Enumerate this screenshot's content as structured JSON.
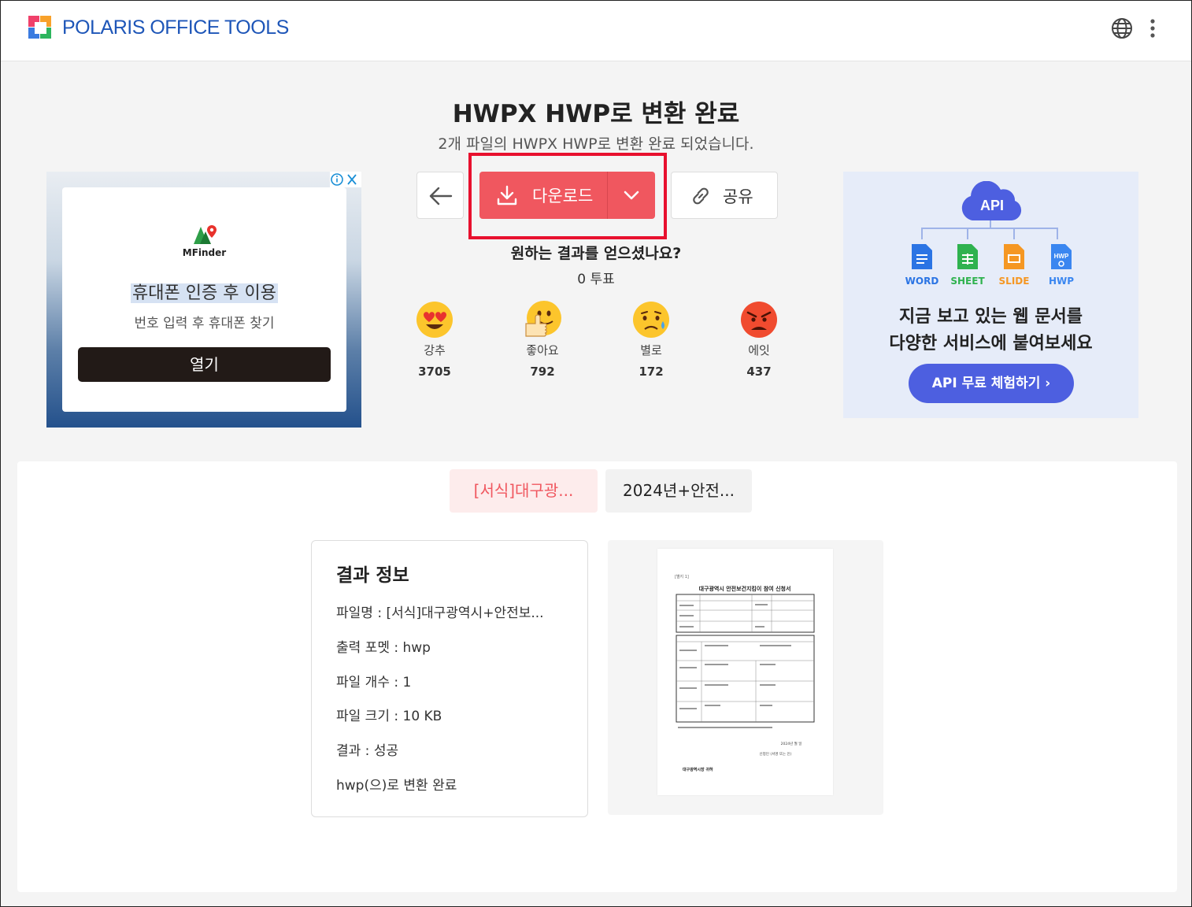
{
  "header": {
    "brand": "POLARIS OFFICE TOOLS",
    "language_icon": "globe-icon",
    "menu_icon": "more-vertical-icon"
  },
  "main": {
    "title": "HWPX HWP로 변환 완료",
    "subtitle": "2개 파일의 HWPX HWP로 변환 완료 되었습니다.",
    "download_label": "다운로드",
    "share_label": "공유",
    "question": "원하는 결과를 얻으셨나요?",
    "votes": "0 투표",
    "reactions": [
      {
        "label": "강추",
        "count": "3705",
        "icon": "heart-eyes-emoji-icon"
      },
      {
        "label": "좋아요",
        "count": "792",
        "icon": "thumbs-up-emoji-icon"
      },
      {
        "label": "별로",
        "count": "172",
        "icon": "sad-emoji-icon"
      },
      {
        "label": "에잇",
        "count": "437",
        "icon": "angry-emoji-icon"
      }
    ]
  },
  "ad_left": {
    "brand": "MFinder",
    "headline": "휴대폰 인증 후 이용",
    "sub": "번호 입력 후 휴대폰 찾기",
    "button": "열기"
  },
  "ad_right": {
    "api_badge": "API",
    "doc_types": [
      "WORD",
      "SHEET",
      "SLIDE",
      "HWP"
    ],
    "line1": "지금 보고 있는 웹 문서를",
    "line2": "다양한 서비스에 붙여보세요",
    "button": "API 무료 체험하기 ›"
  },
  "files": {
    "tabs": [
      "[서식]대구광...",
      "2024년+안전..."
    ],
    "active_tab": 0
  },
  "result": {
    "title": "결과 정보",
    "rows": [
      "파일명 : [서식]대구광역시+안전보...",
      "출력 포멧 : hwp",
      "파일 개수 : 1",
      "파일 크기 : 10 KB",
      "결과 : 성공",
      "hwp(으)로 변환 완료"
    ]
  },
  "preview": {
    "tag": "[별지 1]",
    "doc_title": "대구광역시 안전보건지킴이 참여 신청서",
    "date_line": "2024년   월   일",
    "applicant_line": "신청인               (서명 또는 인)",
    "footer": "대구광역시장 귀하"
  },
  "colors": {
    "accent": "#f0575f",
    "brand": "#1e56b8",
    "api_button": "#4d5fe0",
    "highlight": "#e8102e"
  }
}
